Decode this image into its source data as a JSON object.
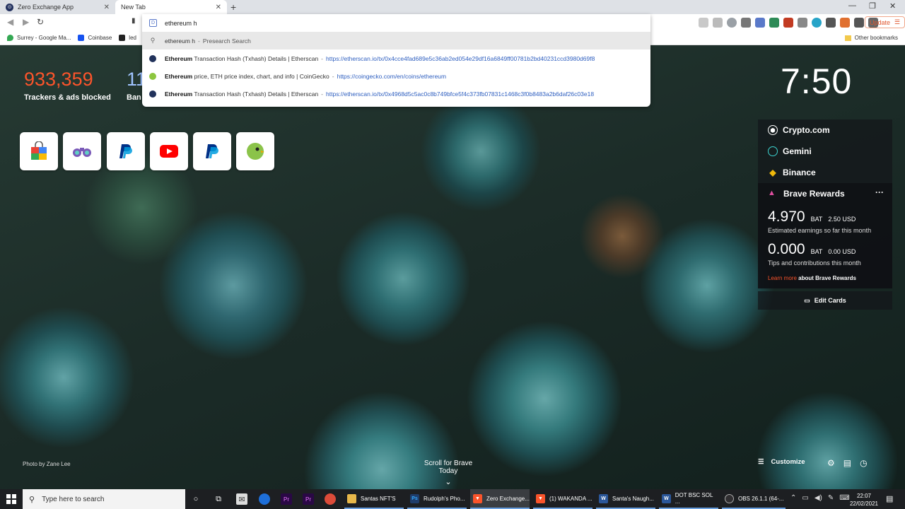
{
  "tabs": [
    {
      "title": "Zero Exchange App",
      "active": false
    },
    {
      "title": "New Tab",
      "active": true
    }
  ],
  "toolbar": {
    "update_label": "Update"
  },
  "bookmarks": {
    "items": [
      "Surrey - Google Ma...",
      "Coinbase",
      "led"
    ],
    "other": "Other bookmarks"
  },
  "omnibox": {
    "query": "ethereum h",
    "suggestions": [
      {
        "type": "search",
        "title": "ethereum h",
        "source": "Presearch Search",
        "url": ""
      },
      {
        "type": "history",
        "title_bold": "Ethereum",
        "title_rest": " Transaction Hash (Txhash) Details | Etherscan",
        "url": "https://etherscan.io/tx/0x4cce4fad689e5c36ab2ed054e29df16a6849ff00781b2bd40231ccd3980d69f8"
      },
      {
        "type": "history",
        "title_bold": "Ethereum",
        "title_rest": " price, ETH price index, chart, and info | CoinGecko",
        "url": "https://coingecko.com/en/coins/ethereum"
      },
      {
        "type": "history",
        "title_bold": "Ethereum",
        "title_rest": " Transaction Hash (Txhash) Details | Etherscan",
        "url": "https://etherscan.io/tx/0x4968d5c5ac0c8b749bfce5f4c373fb07831c1468c3f0b8483a2b6daf26c03e18"
      }
    ]
  },
  "ntp": {
    "stats": [
      {
        "value": "933,359",
        "label": "Trackers & ads blocked",
        "color": "#fb542b"
      },
      {
        "value": "11.",
        "label": "Ban",
        "color": "#a0c4ff"
      }
    ],
    "clock": "7:50",
    "top_sites": [
      "shopping-bag-icon",
      "binoculars-icon",
      "paypal-icon",
      "youtube-icon",
      "paypal-icon",
      "green-bird-icon"
    ],
    "cards": [
      {
        "name": "Crypto.com",
        "icon": "cryptocom-icon"
      },
      {
        "name": "Gemini",
        "icon": "gemini-icon"
      },
      {
        "name": "Binance",
        "icon": "binance-icon"
      }
    ],
    "rewards": {
      "title": "Brave Rewards",
      "earnings_value": "4.970",
      "earnings_currency": "BAT",
      "earnings_usd": "2.50 USD",
      "earnings_caption": "Estimated earnings so far this month",
      "tips_value": "0.000",
      "tips_currency": "BAT",
      "tips_usd": "0.00 USD",
      "tips_caption": "Tips and contributions this month",
      "learn_more": "Learn more",
      "learn_more_rest": " about Brave Rewards"
    },
    "edit_cards": "Edit Cards",
    "photo_credit": "Photo by Zane Lee",
    "scroll_label": "Scroll for Brave Today",
    "customize_label": "Customize"
  },
  "taskbar": {
    "search_placeholder": "Type here to search",
    "apps": [
      {
        "label": "Santas NFT'S",
        "color": "#e8b84a",
        "glyph": ""
      },
      {
        "label": "Rudolph's Pho...",
        "color": "#1f3d6b",
        "glyph": "Ps"
      },
      {
        "label": "Zero Exchange...",
        "color": "#fb542b",
        "glyph": ""
      },
      {
        "label": "(1) WAKANDA ...",
        "color": "#fb542b",
        "glyph": ""
      },
      {
        "label": "Santa's Naugh...",
        "color": "#2b579a",
        "glyph": "W"
      },
      {
        "label": "DOT BSC SOL ...",
        "color": "#2b579a",
        "glyph": "W"
      },
      {
        "label": "OBS 26.1.1 (64-...",
        "color": "#302e31",
        "glyph": ""
      }
    ],
    "time": "22:07",
    "date": "22/02/2021"
  },
  "colors": {
    "brave_orange": "#fb542b",
    "link_blue": "#3060c0"
  }
}
